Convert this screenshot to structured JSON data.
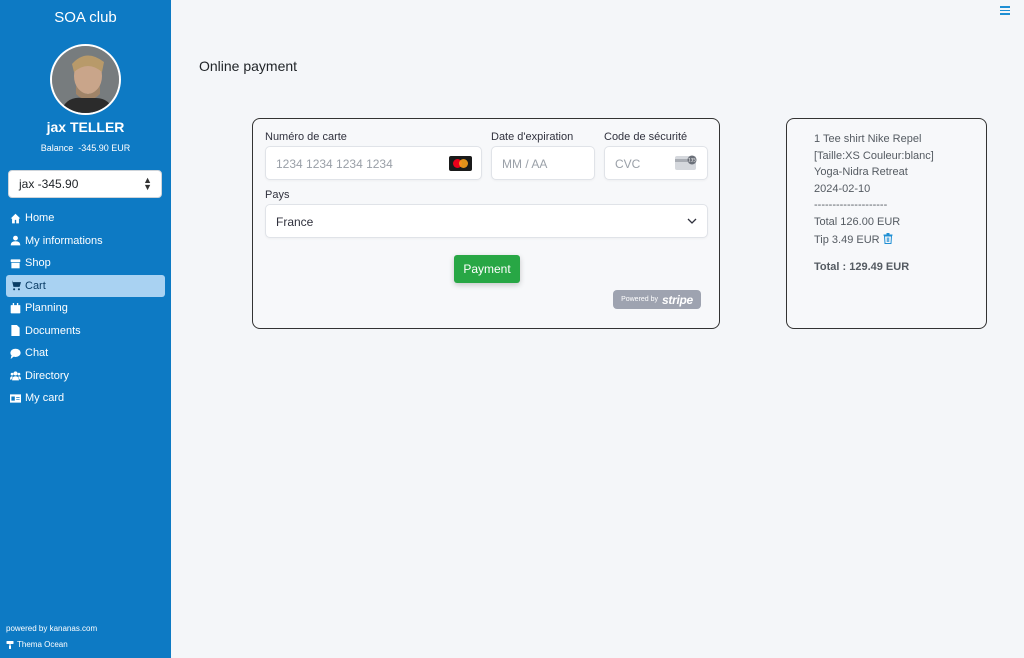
{
  "sidebar": {
    "brand": "SOA club",
    "username": "jax TELLER",
    "balance_label": "Balance",
    "balance_value": "-345.90 EUR",
    "account_select": "jax -345.90",
    "items": [
      {
        "label": "Home",
        "icon": "home-icon"
      },
      {
        "label": "My informations",
        "icon": "user-icon"
      },
      {
        "label": "Shop",
        "icon": "store-icon"
      },
      {
        "label": "Cart",
        "icon": "cart-icon",
        "active": true
      },
      {
        "label": "Planning",
        "icon": "calendar-icon"
      },
      {
        "label": "Documents",
        "icon": "file-icon"
      },
      {
        "label": "Chat",
        "icon": "chat-icon"
      },
      {
        "label": "Directory",
        "icon": "users-icon"
      },
      {
        "label": "My card",
        "icon": "id-card-icon"
      }
    ],
    "footer_powered": "powered by kananas.com",
    "footer_theme": "Thema Ocean",
    "accent": "#0d7ac4",
    "active_bg": "#a9d2f2"
  },
  "main": {
    "title": "Online payment"
  },
  "payment_form": {
    "card_number_label": "Numéro de carte",
    "card_number_placeholder": "1234 1234 1234 1234",
    "expiry_label": "Date d'expiration",
    "expiry_placeholder": "MM / AA",
    "cvc_label": "Code de sécurité",
    "cvc_placeholder": "CVC",
    "country_label": "Pays",
    "country_value": "France",
    "pay_button": "Payment",
    "powered_by": "Powered by",
    "stripe": "stripe",
    "button_color": "#28a745"
  },
  "summary": {
    "item_line1": "1 Tee shirt Nike Repel",
    "item_line2": "[Taille:XS Couleur:blanc]",
    "item_line3": "Yoga-Nidra Retreat",
    "item_line4": "2024-02-10",
    "separator": "--------------------",
    "total": "Total 126.00 EUR",
    "tip": "Tip 3.49 EUR",
    "grand_total": "Total : 129.49 EUR"
  }
}
